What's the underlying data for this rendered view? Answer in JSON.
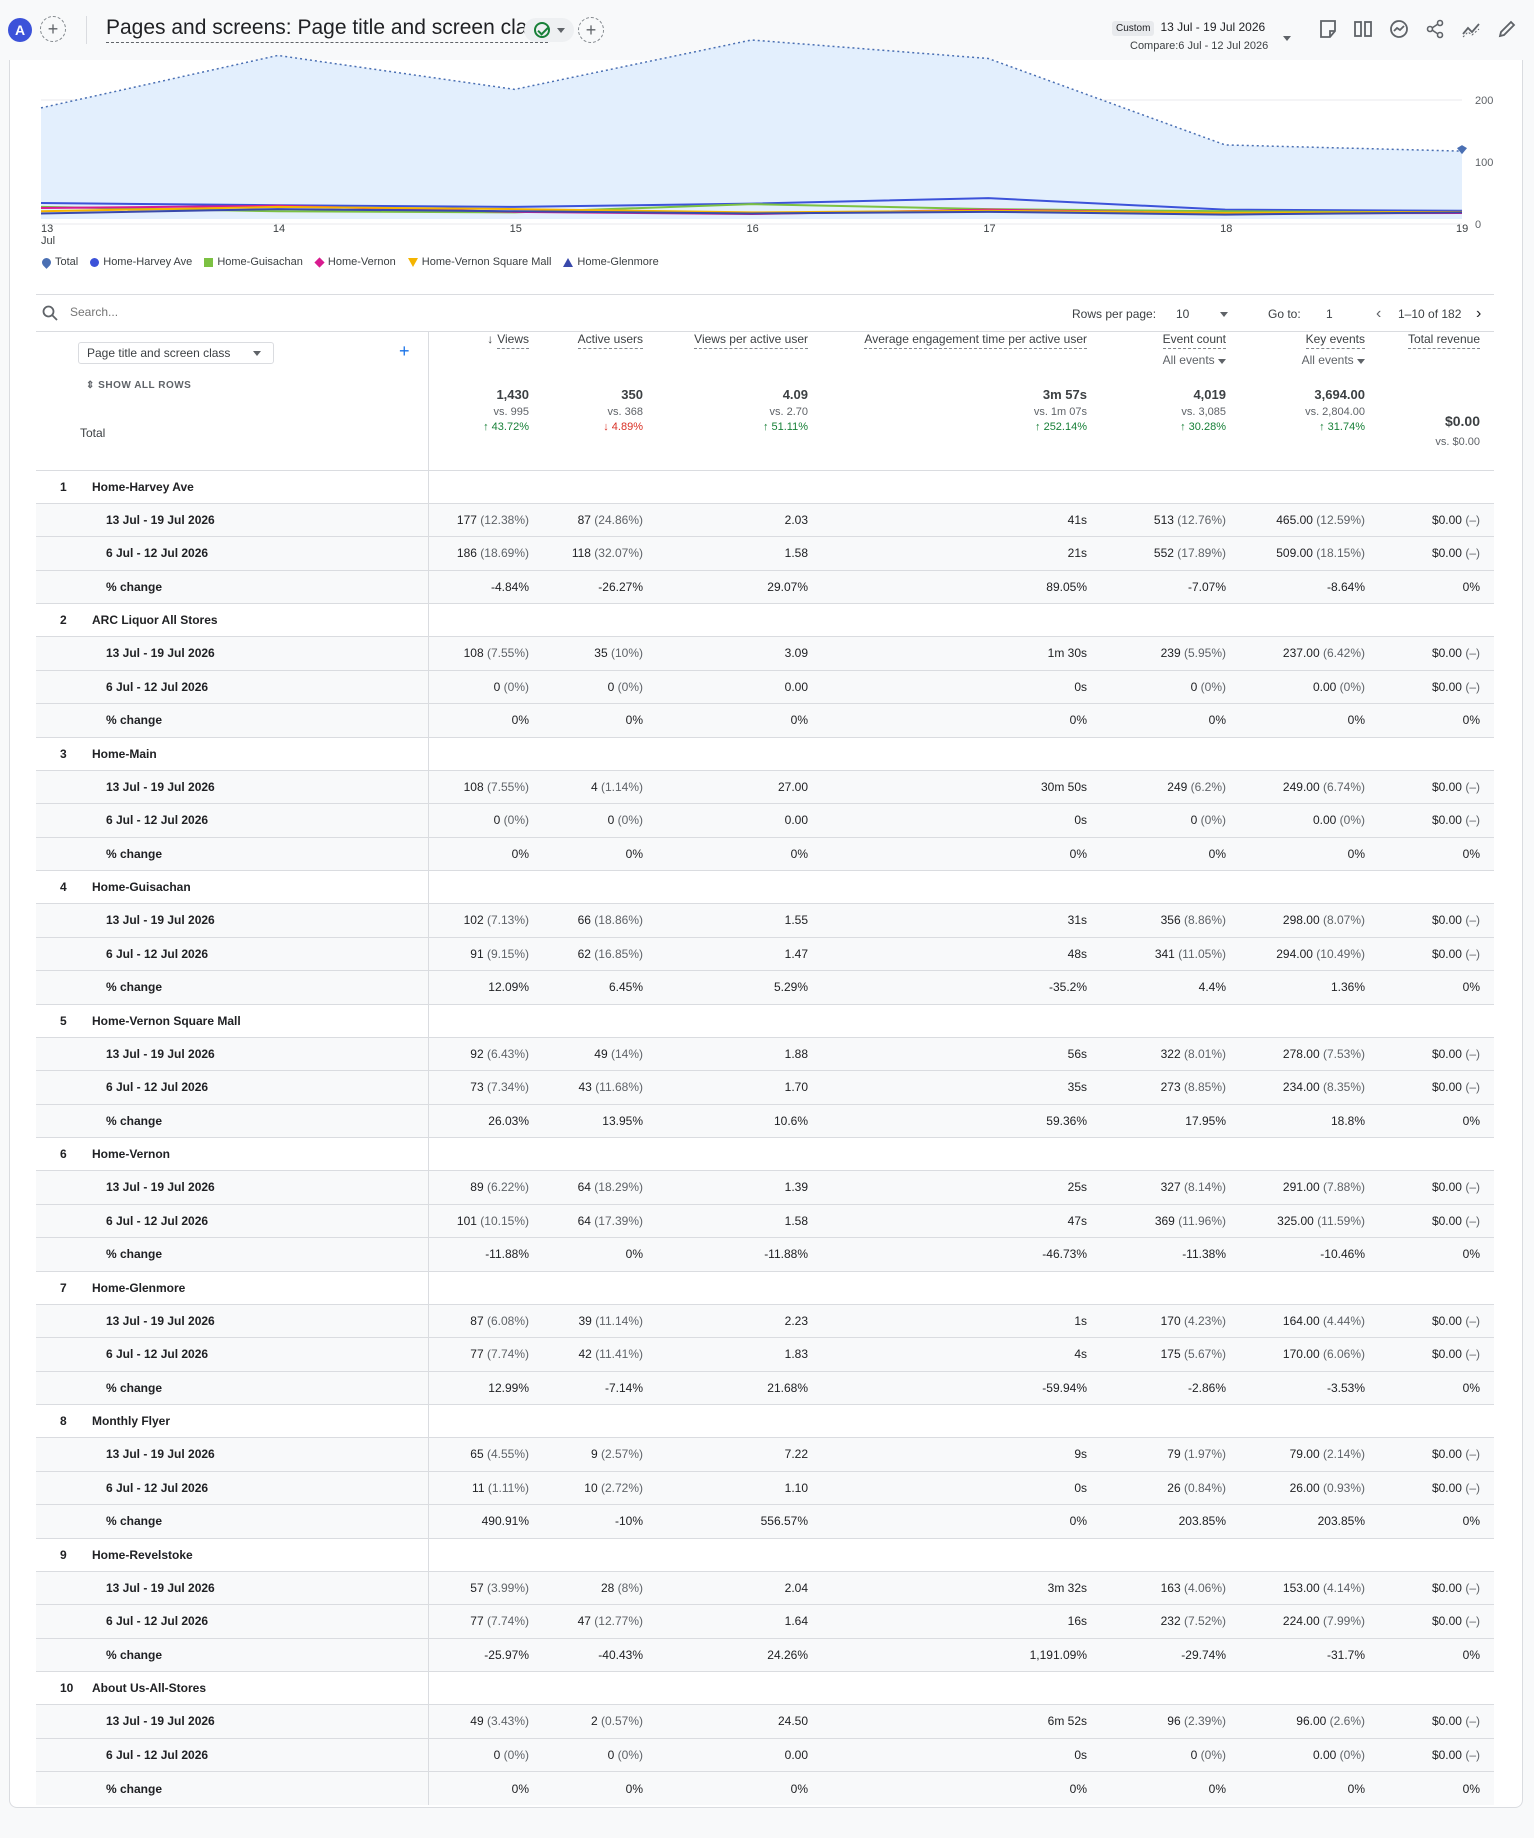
{
  "header": {
    "avatar_letter": "A",
    "title": "Pages and screens: Page title and screen class",
    "date_badge": "Custom",
    "date_range": "13 Jul - 19 Jul 2026",
    "compare": "Compare:6 Jul - 12 Jul 2026"
  },
  "chart_data": {
    "type": "line",
    "x": [
      "13 Jul",
      "14",
      "15",
      "16",
      "17",
      "18",
      "19"
    ],
    "x_tick_labels": [
      "13",
      "14",
      "15",
      "16",
      "17",
      "18",
      "19"
    ],
    "x_first_sub": "Jul",
    "y_right_ticks": [
      "200",
      "100",
      "0"
    ],
    "ylim": [
      0,
      290
    ],
    "series": [
      {
        "name": "Total",
        "color": "#4285f4",
        "type": "area",
        "values": [
          180,
          265,
          210,
          290,
          260,
          120,
          110
        ]
      },
      {
        "name": "Home-Harvey Ave",
        "color": "#3c52d9",
        "values": [
          29,
          25,
          22,
          28,
          38,
          17,
          15
        ]
      },
      {
        "name": "Home-Guisachan",
        "color": "#7cc142",
        "values": [
          22,
          14,
          12,
          27,
          18,
          14,
          12
        ]
      },
      {
        "name": "Home-Vernon",
        "color": "#d81b8f",
        "values": [
          20,
          24,
          13,
          9,
          17,
          10,
          11
        ]
      },
      {
        "name": "Home-Vernon Square Mall",
        "color": "#f4b400",
        "values": [
          14,
          22,
          18,
          12,
          15,
          11,
          13
        ]
      },
      {
        "name": "Home-Glenmore",
        "color": "#3949ab",
        "values": [
          10,
          18,
          14,
          10,
          13,
          8,
          12
        ]
      }
    ],
    "legend": [
      "Total",
      "Home-Harvey Ave",
      "Home-Guisachan",
      "Home-Vernon",
      "Home-Vernon Square Mall",
      "Home-Glenmore"
    ]
  },
  "table": {
    "search_placeholder": "Search...",
    "rows_per_page_label": "Rows per page:",
    "rows_per_page": "10",
    "goto_label": "Go to:",
    "goto_value": "1",
    "page_info": "1–10 of 182",
    "dimension": "Page title and screen class",
    "show_all_rows": "SHOW ALL ROWS",
    "columns": [
      {
        "label": "Views",
        "sort": "↓"
      },
      {
        "label": "Active users"
      },
      {
        "label": "Views per active user"
      },
      {
        "label": "Average engagement time per active user"
      },
      {
        "label": "Event count",
        "sub": "All events"
      },
      {
        "label": "Key events",
        "sub": "All events"
      },
      {
        "label": "Total revenue"
      }
    ],
    "total_label": "Total",
    "totals": [
      {
        "value": "1,430",
        "vs": "vs. 995",
        "change": "43.72%",
        "dir": "up"
      },
      {
        "value": "350",
        "vs": "vs. 368",
        "change": "4.89%",
        "dir": "down"
      },
      {
        "value": "4.09",
        "vs": "vs. 2.70",
        "change": "51.11%",
        "dir": "up"
      },
      {
        "value": "3m 57s",
        "vs": "vs. 1m 07s",
        "change": "252.14%",
        "dir": "up"
      },
      {
        "value": "4,019",
        "vs": "vs. 3,085",
        "change": "30.28%",
        "dir": "up"
      },
      {
        "value": "3,694.00",
        "vs": "vs. 2,804.00",
        "change": "31.74%",
        "dir": "up"
      },
      {
        "value": "$0.00",
        "vs": "vs. $0.00",
        "change": "",
        "dir": ""
      }
    ],
    "period_a": "13 Jul - 19 Jul 2026",
    "period_b": "6 Jul - 12 Jul 2026",
    "change_label": "% change",
    "rows": [
      {
        "rank": "1",
        "name": "Home-Harvey Ave",
        "a": [
          [
            "177",
            "(12.38%)"
          ],
          [
            "87",
            "(24.86%)"
          ],
          [
            "2.03",
            ""
          ],
          [
            "41s",
            ""
          ],
          [
            "513",
            "(12.76%)"
          ],
          [
            "465.00",
            "(12.59%)"
          ],
          [
            "$0.00",
            "(–)"
          ]
        ],
        "b": [
          [
            "186",
            "(18.69%)"
          ],
          [
            "118",
            "(32.07%)"
          ],
          [
            "1.58",
            ""
          ],
          [
            "21s",
            ""
          ],
          [
            "552",
            "(17.89%)"
          ],
          [
            "509.00",
            "(18.15%)"
          ],
          [
            "$0.00",
            "(–)"
          ]
        ],
        "c": [
          "-4.84%",
          "-26.27%",
          "29.07%",
          "89.05%",
          "-7.07%",
          "-8.64%",
          "0%"
        ]
      },
      {
        "rank": "2",
        "name": "ARC Liquor All Stores",
        "a": [
          [
            "108",
            "(7.55%)"
          ],
          [
            "35",
            "(10%)"
          ],
          [
            "3.09",
            ""
          ],
          [
            "1m 30s",
            ""
          ],
          [
            "239",
            "(5.95%)"
          ],
          [
            "237.00",
            "(6.42%)"
          ],
          [
            "$0.00",
            "(–)"
          ]
        ],
        "b": [
          [
            "0",
            "(0%)"
          ],
          [
            "0",
            "(0%)"
          ],
          [
            "0.00",
            ""
          ],
          [
            "0s",
            ""
          ],
          [
            "0",
            "(0%)"
          ],
          [
            "0.00",
            "(0%)"
          ],
          [
            "$0.00",
            "(–)"
          ]
        ],
        "c": [
          "0%",
          "0%",
          "0%",
          "0%",
          "0%",
          "0%",
          "0%"
        ]
      },
      {
        "rank": "3",
        "name": "Home-Main",
        "a": [
          [
            "108",
            "(7.55%)"
          ],
          [
            "4",
            "(1.14%)"
          ],
          [
            "27.00",
            ""
          ],
          [
            "30m 50s",
            ""
          ],
          [
            "249",
            "(6.2%)"
          ],
          [
            "249.00",
            "(6.74%)"
          ],
          [
            "$0.00",
            "(–)"
          ]
        ],
        "b": [
          [
            "0",
            "(0%)"
          ],
          [
            "0",
            "(0%)"
          ],
          [
            "0.00",
            ""
          ],
          [
            "0s",
            ""
          ],
          [
            "0",
            "(0%)"
          ],
          [
            "0.00",
            "(0%)"
          ],
          [
            "$0.00",
            "(–)"
          ]
        ],
        "c": [
          "0%",
          "0%",
          "0%",
          "0%",
          "0%",
          "0%",
          "0%"
        ]
      },
      {
        "rank": "4",
        "name": "Home-Guisachan",
        "a": [
          [
            "102",
            "(7.13%)"
          ],
          [
            "66",
            "(18.86%)"
          ],
          [
            "1.55",
            ""
          ],
          [
            "31s",
            ""
          ],
          [
            "356",
            "(8.86%)"
          ],
          [
            "298.00",
            "(8.07%)"
          ],
          [
            "$0.00",
            "(–)"
          ]
        ],
        "b": [
          [
            "91",
            "(9.15%)"
          ],
          [
            "62",
            "(16.85%)"
          ],
          [
            "1.47",
            ""
          ],
          [
            "48s",
            ""
          ],
          [
            "341",
            "(11.05%)"
          ],
          [
            "294.00",
            "(10.49%)"
          ],
          [
            "$0.00",
            "(–)"
          ]
        ],
        "c": [
          "12.09%",
          "6.45%",
          "5.29%",
          "-35.2%",
          "4.4%",
          "1.36%",
          "0%"
        ]
      },
      {
        "rank": "5",
        "name": "Home-Vernon Square Mall",
        "a": [
          [
            "92",
            "(6.43%)"
          ],
          [
            "49",
            "(14%)"
          ],
          [
            "1.88",
            ""
          ],
          [
            "56s",
            ""
          ],
          [
            "322",
            "(8.01%)"
          ],
          [
            "278.00",
            "(7.53%)"
          ],
          [
            "$0.00",
            "(–)"
          ]
        ],
        "b": [
          [
            "73",
            "(7.34%)"
          ],
          [
            "43",
            "(11.68%)"
          ],
          [
            "1.70",
            ""
          ],
          [
            "35s",
            ""
          ],
          [
            "273",
            "(8.85%)"
          ],
          [
            "234.00",
            "(8.35%)"
          ],
          [
            "$0.00",
            "(–)"
          ]
        ],
        "c": [
          "26.03%",
          "13.95%",
          "10.6%",
          "59.36%",
          "17.95%",
          "18.8%",
          "0%"
        ]
      },
      {
        "rank": "6",
        "name": "Home-Vernon",
        "a": [
          [
            "89",
            "(6.22%)"
          ],
          [
            "64",
            "(18.29%)"
          ],
          [
            "1.39",
            ""
          ],
          [
            "25s",
            ""
          ],
          [
            "327",
            "(8.14%)"
          ],
          [
            "291.00",
            "(7.88%)"
          ],
          [
            "$0.00",
            "(–)"
          ]
        ],
        "b": [
          [
            "101",
            "(10.15%)"
          ],
          [
            "64",
            "(17.39%)"
          ],
          [
            "1.58",
            ""
          ],
          [
            "47s",
            ""
          ],
          [
            "369",
            "(11.96%)"
          ],
          [
            "325.00",
            "(11.59%)"
          ],
          [
            "$0.00",
            "(–)"
          ]
        ],
        "c": [
          "-11.88%",
          "0%",
          "-11.88%",
          "-46.73%",
          "-11.38%",
          "-10.46%",
          "0%"
        ]
      },
      {
        "rank": "7",
        "name": "Home-Glenmore",
        "a": [
          [
            "87",
            "(6.08%)"
          ],
          [
            "39",
            "(11.14%)"
          ],
          [
            "2.23",
            ""
          ],
          [
            "1s",
            ""
          ],
          [
            "170",
            "(4.23%)"
          ],
          [
            "164.00",
            "(4.44%)"
          ],
          [
            "$0.00",
            "(–)"
          ]
        ],
        "b": [
          [
            "77",
            "(7.74%)"
          ],
          [
            "42",
            "(11.41%)"
          ],
          [
            "1.83",
            ""
          ],
          [
            "4s",
            ""
          ],
          [
            "175",
            "(5.67%)"
          ],
          [
            "170.00",
            "(6.06%)"
          ],
          [
            "$0.00",
            "(–)"
          ]
        ],
        "c": [
          "12.99%",
          "-7.14%",
          "21.68%",
          "-59.94%",
          "-2.86%",
          "-3.53%",
          "0%"
        ]
      },
      {
        "rank": "8",
        "name": "Monthly Flyer",
        "a": [
          [
            "65",
            "(4.55%)"
          ],
          [
            "9",
            "(2.57%)"
          ],
          [
            "7.22",
            ""
          ],
          [
            "9s",
            ""
          ],
          [
            "79",
            "(1.97%)"
          ],
          [
            "79.00",
            "(2.14%)"
          ],
          [
            "$0.00",
            "(–)"
          ]
        ],
        "b": [
          [
            "11",
            "(1.11%)"
          ],
          [
            "10",
            "(2.72%)"
          ],
          [
            "1.10",
            ""
          ],
          [
            "0s",
            ""
          ],
          [
            "26",
            "(0.84%)"
          ],
          [
            "26.00",
            "(0.93%)"
          ],
          [
            "$0.00",
            "(–)"
          ]
        ],
        "c": [
          "490.91%",
          "-10%",
          "556.57%",
          "0%",
          "203.85%",
          "203.85%",
          "0%"
        ]
      },
      {
        "rank": "9",
        "name": "Home-Revelstoke",
        "a": [
          [
            "57",
            "(3.99%)"
          ],
          [
            "28",
            "(8%)"
          ],
          [
            "2.04",
            ""
          ],
          [
            "3m 32s",
            ""
          ],
          [
            "163",
            "(4.06%)"
          ],
          [
            "153.00",
            "(4.14%)"
          ],
          [
            "$0.00",
            "(–)"
          ]
        ],
        "b": [
          [
            "77",
            "(7.74%)"
          ],
          [
            "47",
            "(12.77%)"
          ],
          [
            "1.64",
            ""
          ],
          [
            "16s",
            ""
          ],
          [
            "232",
            "(7.52%)"
          ],
          [
            "224.00",
            "(7.99%)"
          ],
          [
            "$0.00",
            "(–)"
          ]
        ],
        "c": [
          "-25.97%",
          "-40.43%",
          "24.26%",
          "1,191.09%",
          "-29.74%",
          "-31.7%",
          "0%"
        ]
      },
      {
        "rank": "10",
        "name": "About Us-All-Stores",
        "a": [
          [
            "49",
            "(3.43%)"
          ],
          [
            "2",
            "(0.57%)"
          ],
          [
            "24.50",
            ""
          ],
          [
            "6m 52s",
            ""
          ],
          [
            "96",
            "(2.39%)"
          ],
          [
            "96.00",
            "(2.6%)"
          ],
          [
            "$0.00",
            "(–)"
          ]
        ],
        "b": [
          [
            "0",
            "(0%)"
          ],
          [
            "0",
            "(0%)"
          ],
          [
            "0.00",
            ""
          ],
          [
            "0s",
            ""
          ],
          [
            "0",
            "(0%)"
          ],
          [
            "0.00",
            "(0%)"
          ],
          [
            "$0.00",
            "(–)"
          ]
        ],
        "c": [
          "0%",
          "0%",
          "0%",
          "0%",
          "0%",
          "0%",
          "0%"
        ]
      }
    ]
  }
}
